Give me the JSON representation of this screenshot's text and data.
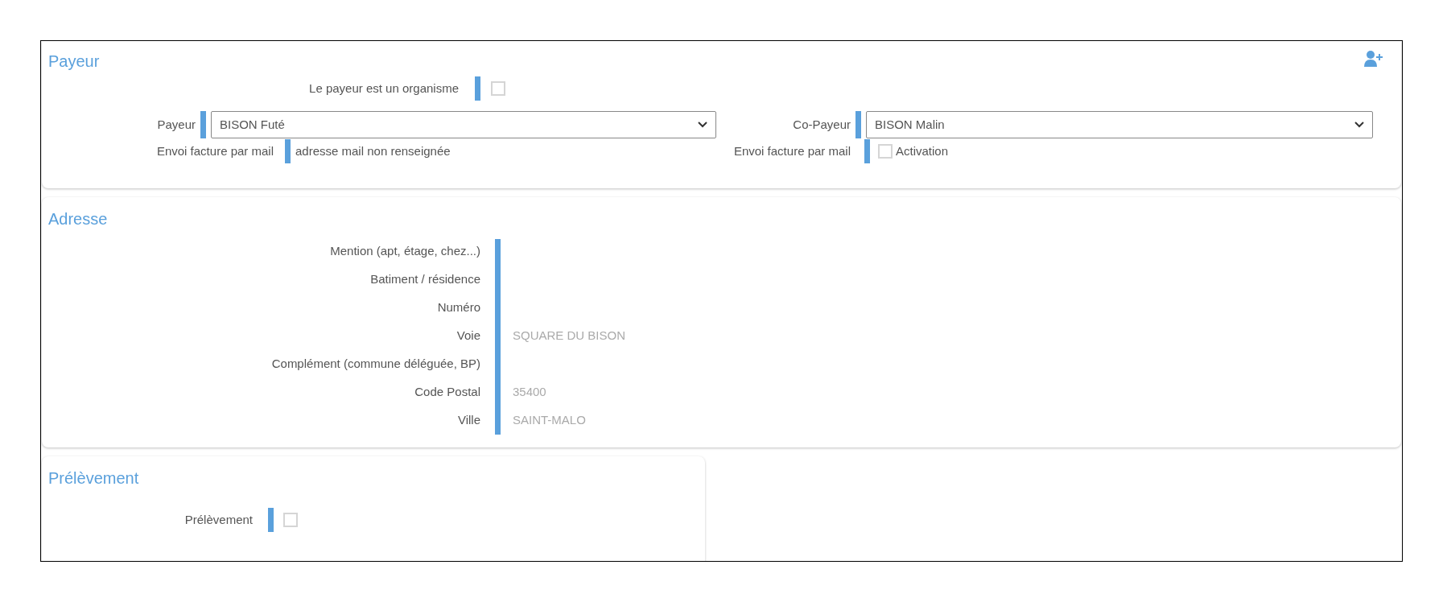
{
  "payer": {
    "title": "Payeur",
    "organism": {
      "label": "Le payeur est un organisme",
      "checked": false
    },
    "payer_select": {
      "label": "Payeur",
      "value": "BISON Futé"
    },
    "payer_mail": {
      "label": "Envoi facture par mail",
      "value": "adresse mail non renseignée"
    },
    "copayer_select": {
      "label": "Co-Payeur",
      "value": "BISON Malin"
    },
    "copayer_mail": {
      "label": "Envoi facture par mail",
      "option": "Activation",
      "checked": false
    }
  },
  "address": {
    "title": "Adresse",
    "fields": [
      {
        "label": "Mention (apt, étage, chez...)"
      },
      {
        "label": "Batiment / résidence"
      },
      {
        "label": "Numéro"
      },
      {
        "label": "Voie",
        "value": "SQUARE DU BISON"
      },
      {
        "label": "Complément (commune déléguée, BP)"
      },
      {
        "label": "Code Postal",
        "value": "35400"
      },
      {
        "label": "Ville",
        "value": "SAINT-MALO"
      }
    ]
  },
  "debit": {
    "title": "Prélèvement",
    "field": {
      "label": "Prélèvement",
      "checked": false
    }
  }
}
